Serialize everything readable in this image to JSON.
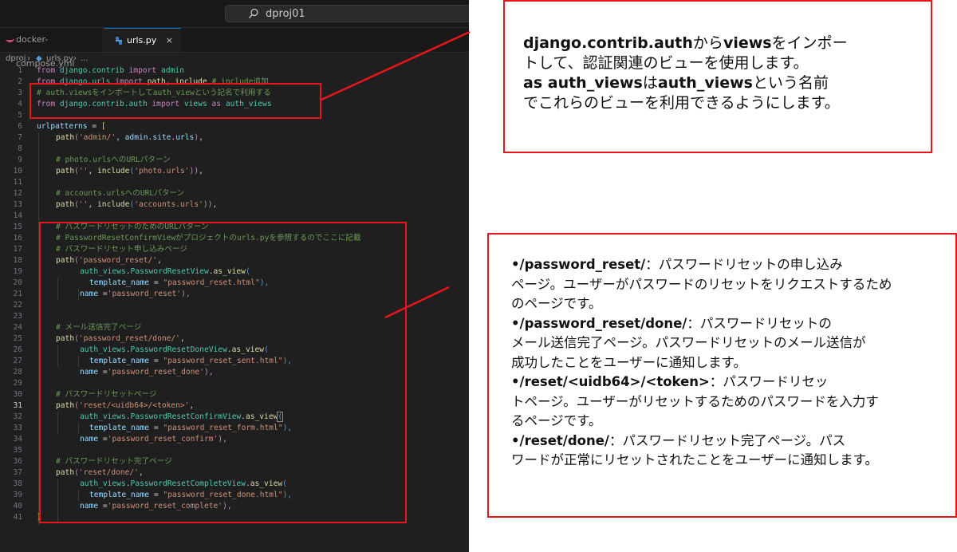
{
  "titlebar": {
    "search_text": "dproj01"
  },
  "tabs": [
    {
      "label": "docker-compose.yml",
      "close": ""
    },
    {
      "label": "urls.py",
      "close": "×"
    }
  ],
  "breadcrumb": {
    "folder": "dproj",
    "sep1": "›",
    "file": "urls.py",
    "sep2": "›",
    "rest": "..."
  },
  "colors": {
    "accent": "#0078d4",
    "highlight_box": "#e8151a",
    "editor_bg": "#1f1f1f"
  },
  "line_numbers": [
    "1",
    "2",
    "3",
    "4",
    "5",
    "6",
    "7",
    "8",
    "9",
    "10",
    "11",
    "12",
    "13",
    "14",
    "15",
    "16",
    "17",
    "18",
    "19",
    "20",
    "21",
    "22",
    "23",
    "24",
    "25",
    "26",
    "27",
    "28",
    "29",
    "30",
    "31",
    "32",
    "33",
    "34",
    "35",
    "36",
    "37",
    "38",
    "39",
    "40",
    "41"
  ],
  "active_line": "31",
  "code": {
    "l1_a": "from",
    "l1_b": " django.contrib ",
    "l1_c": "import",
    "l1_d": " admin",
    "l2_a": "from",
    "l2_b": " django.urls ",
    "l2_c": "import",
    "l2_d": " path, include ",
    "l2_e": "# include追加",
    "l3": "# auth.viewsをインポートしてauth_viewという記名で利用する",
    "l4_a": "from",
    "l4_b": " django.contrib.auth ",
    "l4_c": "import",
    "l4_d": " views ",
    "l4_e": "as",
    "l4_f": " auth_views",
    "l6_a": "urlpatterns",
    "l6_b": " = ",
    "l6_c": "[",
    "l7_a": "path",
    "l7_b": "(",
    "l7_c": "'admin/'",
    "l7_d": ", admin.site.urls",
    "l7_e": ")",
    "l7_f": ",",
    "l9": "# photo.urlsへのURLパターン",
    "l10_a": "path",
    "l10_b": "(",
    "l10_c": "''",
    "l10_d": ", ",
    "l10_e": "include",
    "l10_f": "(",
    "l10_g": "'photo.urls'",
    "l10_h": "))",
    "l10_i": ",",
    "l12": "# accounts.urlsへのURLパターン",
    "l13_a": "path",
    "l13_b": "(",
    "l13_c": "''",
    "l13_d": ", ",
    "l13_e": "include",
    "l13_f": "(",
    "l13_g": "'accounts.urls'",
    "l13_h": "))",
    "l13_i": ",",
    "l15": "# パスワードリセットのためのURLパターン",
    "l16": "# PasswordResetConfirmViewがプロジェクトのurls.pyを参照するのでここに記載",
    "l17": "# パスワードリセット申し込みページ",
    "l18_a": "path",
    "l18_b": "(",
    "l18_c": "'password_reset/'",
    "l18_d": ",",
    "l19_a": "auth_views",
    "l19_b": ".",
    "l19_c": "PasswordResetView",
    "l19_d": ".",
    "l19_e": "as_view",
    "l19_f": "(",
    "l20_a": "template_name",
    "l20_b": " = ",
    "l20_c": "\"password_reset.html\"",
    "l20_d": "),",
    "l21_a": "name",
    "l21_b": " =",
    "l21_c": "'password_reset'",
    "l21_d": "),",
    "l23": "# メール送信完了ページ",
    "l24_a": "path",
    "l24_b": "(",
    "l24_c": "'password_reset/done/'",
    "l24_d": ",",
    "l25_a": "auth_views",
    "l25_b": ".",
    "l25_c": "PasswordResetDoneView",
    "l25_d": ".",
    "l25_e": "as_view",
    "l25_f": "(",
    "l26_a": "template_name",
    "l26_b": " = ",
    "l26_c": "\"password_reset_sent.html\"",
    "l26_d": "),",
    "l27_a": "name",
    "l27_b": " =",
    "l27_c": "'password_reset_done'",
    "l27_d": "),",
    "l29": "# パスワードリセットページ",
    "l30_a": "path",
    "l30_b": "(",
    "l30_c": "'reset/<uidb64>/<token>'",
    "l30_d": ",",
    "l31_a": "auth_views",
    "l31_b": ".",
    "l31_c": "PasswordResetConfirmView",
    "l31_d": ".",
    "l31_e": "as_view",
    "l31_f": "(",
    "l32_a": "template_name",
    "l32_b": " = ",
    "l32_c": "\"password_reset_form.html\"",
    "l32_d": "),",
    "l33_a": "name",
    "l33_b": " =",
    "l33_c": "'password_reset_confirm'",
    "l33_d": "),",
    "l35": "# パスワードリセット完了ページ",
    "l36_a": "path",
    "l36_b": "(",
    "l36_c": "'reset/done/'",
    "l36_d": ",",
    "l37_a": "auth_views",
    "l37_b": ".",
    "l37_c": "PasswordResetCompleteView",
    "l37_d": ".",
    "l37_e": "as_view",
    "l37_f": "(",
    "l38_a": "template_name",
    "l38_b": " = ",
    "l38_c": "\"password_reset_done.html\"",
    "l38_d": "),",
    "l39_a": "name",
    "l39_b": " =",
    "l39_c": "'password_reset_complete'",
    "l39_d": "),",
    "l40": "]"
  },
  "callout_top": {
    "l1_b1": "django.contrib.auth",
    "l1_t1": "から",
    "l1_b2": "views",
    "l1_t2": "をインポー",
    "l2": "トして、認証関連のビューを使用します。",
    "l3_b1": "as auth_views",
    "l3_t1": "は",
    "l3_b2": "auth_views",
    "l3_t2": "という名前",
    "l4": "でこれらのビューを利用できるようにします。"
  },
  "callout_bottom": {
    "i1_b": "•/password_reset/",
    "i1_t": "：パスワードリセットの申し込み",
    "i1_l2": "ページ。ユーザーがパスワードのリセットをリクエストするため",
    "i1_l3": "のページです。",
    "i2_b": "•/password_reset/done/",
    "i2_t": "：パスワードリセットの",
    "i2_l2": "メール送信完了ページ。パスワードリセットのメール送信が",
    "i2_l3": "成功したことをユーザーに通知します。",
    "i3_b": "•/reset/<uidb64>/<token>",
    "i3_t": "：パスワードリセッ",
    "i3_l2": "トページ。ユーザーがリセットするためのパスワードを入力す",
    "i3_l3": "るページです。",
    "i4_b": "•/reset/done/",
    "i4_t": "：パスワードリセット完了ページ。パス",
    "i4_l2": "ワードが正常にリセットされたことをユーザーに通知します。"
  }
}
